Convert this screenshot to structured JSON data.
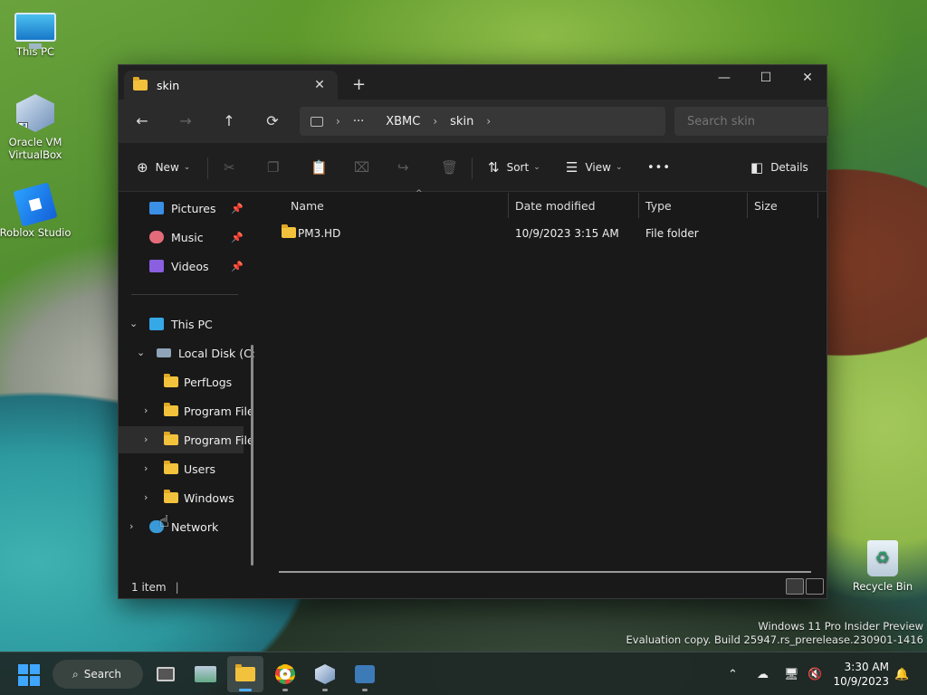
{
  "desktop": {
    "icons": [
      {
        "label": "This PC"
      },
      {
        "label": "Oracle VM VirtualBox"
      },
      {
        "label": "Roblox Studio"
      },
      {
        "label": "Recycle Bin"
      }
    ],
    "watermark_line1": "Windows 11 Pro Insider Preview",
    "watermark_line2": "Evaluation copy. Build 25947.rs_prerelease.230901-1416"
  },
  "explorer": {
    "tab_title": "skin",
    "tab_close": "✕",
    "new_tab": "+",
    "window_controls": {
      "minimize": "—",
      "maximize": "☐",
      "close": "✕"
    },
    "nav": {
      "back": "←",
      "forward": "→",
      "up": "↑",
      "refresh": "⟳"
    },
    "breadcrumb": {
      "more": "···",
      "items": [
        "XBMC",
        "skin"
      ]
    },
    "search_placeholder": "Search skin",
    "toolbar": {
      "new_label": "New",
      "sort_label": "Sort",
      "view_label": "View",
      "more": "•••",
      "details_label": "Details"
    },
    "sidebar": {
      "quick": [
        {
          "label": "Pictures",
          "color": "#3a8fe6"
        },
        {
          "label": "Music",
          "color": "#e46b7a"
        },
        {
          "label": "Videos",
          "color": "#8a5fe0"
        }
      ],
      "this_pc": "This PC",
      "local_disk": "Local Disk (C:)",
      "folders": [
        "PerfLogs",
        "Program File",
        "Program File",
        "Users",
        "Windows"
      ],
      "network": "Network"
    },
    "columns": [
      "Name",
      "Date modified",
      "Type",
      "Size"
    ],
    "files": [
      {
        "name": "PM3.HD",
        "date": "10/9/2023 3:15 AM",
        "type": "File folder",
        "size": ""
      }
    ],
    "status": "1 item"
  },
  "taskbar": {
    "search_label": "Search",
    "apps": [
      "task-view-icon",
      "stock-app-icon",
      "file-explorer-icon",
      "chrome-icon",
      "virtualbox-icon",
      "ai-app-icon"
    ],
    "time": "3:30 AM",
    "date": "10/9/2023"
  },
  "colors": {
    "accent": "#4fb0ff",
    "folder": "#f3c23c",
    "window_bg": "#191919"
  }
}
